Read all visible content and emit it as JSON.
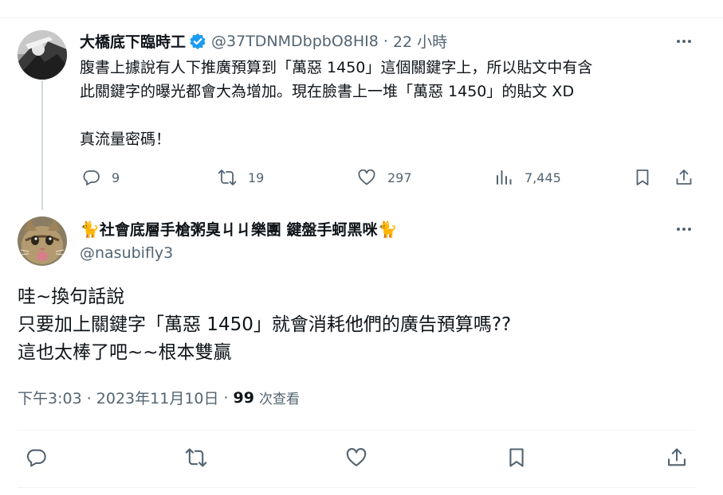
{
  "tweet": {
    "author_name": "大橋底下臨時工",
    "handle": "@37TDNMDbpbO8HI8",
    "separator": "·",
    "time_ago": "22 小時",
    "text_lines": [
      "腹書上據說有人下推廣預算到「萬惡 1450」這個關鍵字上，所以貼文中有含",
      "此關鍵字的曝光都會大為增加。現在臉書上一堆「萬惡 1450」的貼文 XD",
      "真流量密碼！"
    ],
    "stats": {
      "replies": "9",
      "reposts": "19",
      "likes": "297",
      "views": "7,445"
    },
    "icons": {
      "verified": "verified-badge-icon",
      "more": "more-icon",
      "reply": "reply-icon",
      "repost": "repost-icon",
      "like": "heart-icon",
      "views": "analytics-icon",
      "bookmark": "bookmark-icon",
      "share": "share-icon"
    }
  },
  "reply": {
    "author_emoji": "🐈",
    "author_name": "社會底層手槍粥臭ㄐㄐ樂團 鍵盤手蚵黑咪",
    "handle": "@nasubifly3",
    "text_lines": [
      "哇~換句話說",
      "只要加上關鍵字「萬惡 1450」就會消耗他們的廣告預算嗎??",
      "這也太棒了吧~~根本雙贏"
    ],
    "timestamp": "下午3:03 · 2023年11月10日",
    "separator": "·",
    "views_count": "99",
    "views_label": "次查看"
  },
  "colors": {
    "primary_text": "#0f1419",
    "secondary_text": "#536471",
    "verified_blue": "#1d9bf0",
    "divider": "#eff3f4",
    "thread_line": "#cfd9de"
  }
}
